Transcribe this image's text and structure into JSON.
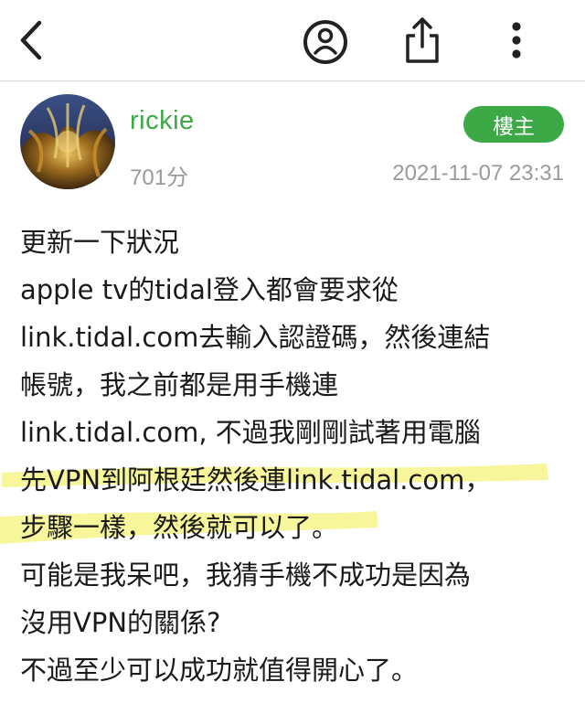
{
  "nav": {
    "back_icon": "back-chevron-icon",
    "profile_icon": "user-circle-icon",
    "share_icon": "share-icon",
    "more_icon": "more-vertical-icon"
  },
  "author": {
    "name": "rickie",
    "score": "701分",
    "badge": "樓主",
    "timestamp": "2021-11-07 23:31"
  },
  "post": {
    "lines": [
      "更新一下狀況",
      "apple tv的tidal登入都會要求從",
      "link.tidal.com去輸入認證碼，然後連結",
      "帳號，我之前都是用手機連",
      "link.tidal.com, 不過我剛剛試著用電腦",
      "先VPN到阿根廷然後連link.tidal.com，",
      "步驟一樣，然後就可以了。",
      "可能是我呆吧，我猜手機不成功是因為",
      "沒用VPN的關係?",
      "不過至少可以成功就值得開心了。"
    ]
  },
  "colors": {
    "accent_green": "#3ca946",
    "muted_gray": "#9a9a9a",
    "highlight_yellow": "#f6f58a"
  }
}
